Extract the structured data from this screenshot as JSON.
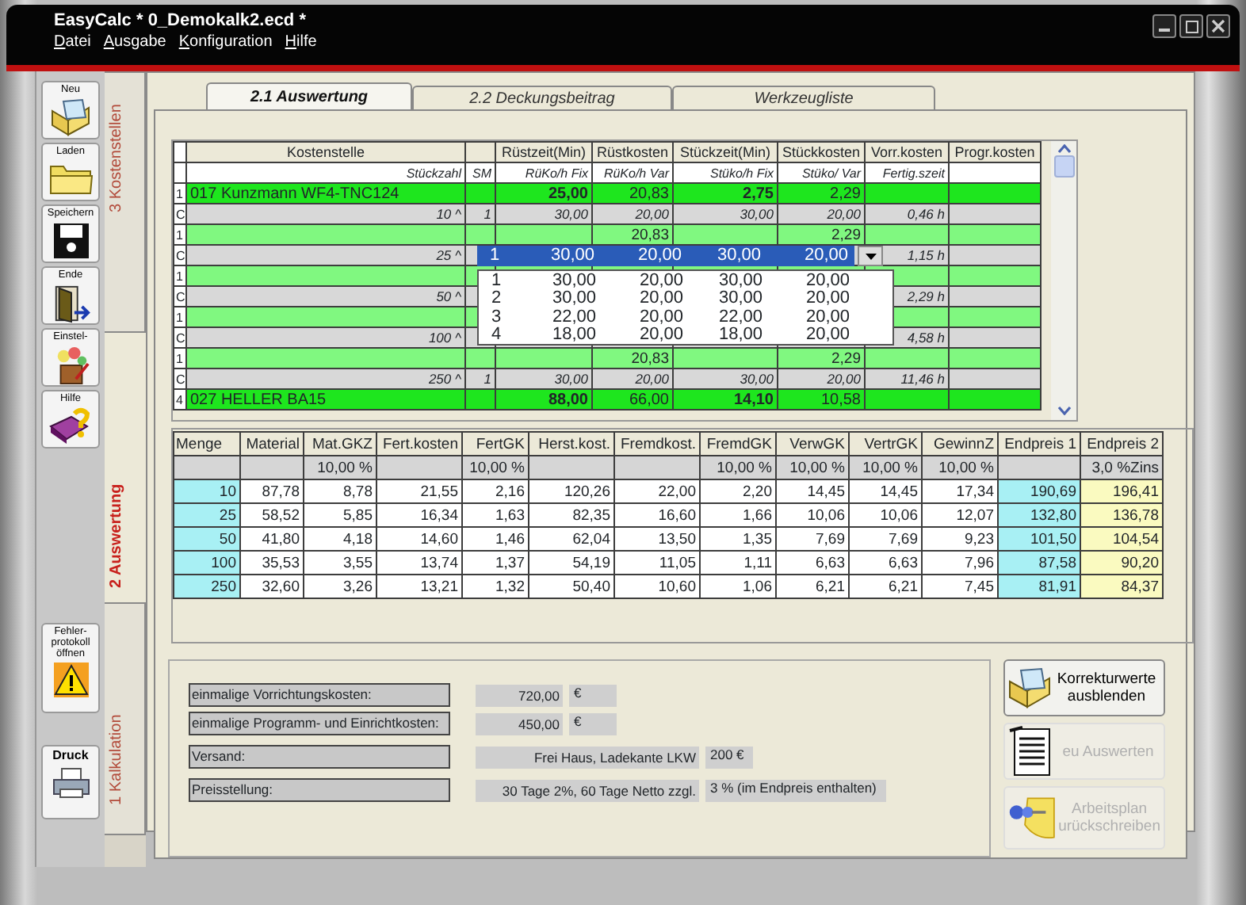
{
  "window": {
    "title": "EasyCalc * 0_Demokalk2.ecd *",
    "menu": [
      "Datei",
      "Ausgabe",
      "Konfiguration",
      "Hilfe"
    ]
  },
  "toolbar": [
    {
      "label": "Neu",
      "kind": "new"
    },
    {
      "label": "Laden",
      "kind": "open"
    },
    {
      "label": "Speichern",
      "kind": "save"
    },
    {
      "label": "Ende",
      "kind": "exit"
    },
    {
      "label": "Einstel-",
      "kind": "settings"
    },
    {
      "label": "Hilfe",
      "kind": "help"
    }
  ],
  "toolbar_lower": [
    {
      "label": "Fehler-protokoll öffnen",
      "kind": "errorlog"
    },
    {
      "label": "Druck",
      "kind": "print"
    }
  ],
  "side_tabs": [
    {
      "label": "3 Kostenstellen",
      "selected": false
    },
    {
      "label": "2 Auswertung",
      "selected": true
    },
    {
      "label": "1 Kalkulation",
      "selected": false
    }
  ],
  "tabs": [
    {
      "label": "2.1 Auswertung",
      "selected": true
    },
    {
      "label": "2.2 Deckungsbeitrag",
      "selected": false
    },
    {
      "label": "Werkzeugliste",
      "selected": false
    }
  ],
  "cost_table": {
    "columns": [
      {
        "header": "Kostenstelle",
        "sub": "Stückzahl"
      },
      {
        "sub": "SM"
      },
      {
        "header": "Rüstzeit(Min)",
        "sub": "RüKo/h Fix"
      },
      {
        "header": "Rüstkosten",
        "sub": "RüKo/h Var"
      },
      {
        "header": "Stückzeit(Min)",
        "sub": "Stüko/h Fix"
      },
      {
        "header": "Stückkosten",
        "sub": "Stüko/ Var"
      },
      {
        "header": "Vorr.kosten",
        "sub": "Fertig.szeit"
      },
      {
        "header": "Progr.kosten"
      }
    ],
    "rows": [
      {
        "index": "1",
        "kind": "machine",
        "cells": [
          "017 Kunzmann WF4-TNC124",
          null,
          "25,00",
          "20,83",
          "2,75",
          "2,29",
          null,
          null
        ]
      },
      {
        "index": "C",
        "kind": "qty",
        "cells": [
          "10 ^",
          "1",
          "30,00",
          "20,00",
          "30,00",
          "20,00",
          "0,46 h",
          null
        ]
      },
      {
        "index": "1",
        "kind": "sum",
        "cells": [
          null,
          null,
          null,
          "20,83",
          null,
          "2,29",
          null,
          null
        ]
      },
      {
        "index": "C",
        "kind": "qty",
        "cells": [
          "25 ^",
          null,
          null,
          null,
          null,
          null,
          "1,15 h",
          null
        ]
      },
      {
        "index": "1",
        "kind": "sum",
        "cells": [
          null,
          null,
          null,
          null,
          null,
          null,
          null,
          null
        ]
      },
      {
        "index": "C",
        "kind": "qty",
        "cells": [
          "50 ^",
          null,
          null,
          null,
          null,
          null,
          "2,29 h",
          null
        ]
      },
      {
        "index": "1",
        "kind": "sum",
        "cells": [
          null,
          null,
          null,
          null,
          null,
          null,
          null,
          null
        ]
      },
      {
        "index": "C",
        "kind": "qty",
        "cells": [
          "100 ^",
          null,
          null,
          null,
          null,
          null,
          "4,58 h",
          null
        ]
      },
      {
        "index": "1",
        "kind": "sum",
        "cells": [
          null,
          null,
          null,
          "20,83",
          null,
          "2,29",
          null,
          null
        ]
      },
      {
        "index": "C",
        "kind": "qty",
        "cells": [
          "250 ^",
          "1",
          "30,00",
          "20,00",
          "30,00",
          "20,00",
          "11,46 h",
          null
        ]
      },
      {
        "index": "4",
        "kind": "machine",
        "cells": [
          "027 HELLER BA15",
          null,
          "88,00",
          "66,00",
          "14,10",
          "10,58",
          null,
          null
        ]
      }
    ],
    "combo": {
      "value": [
        "1",
        "30,00",
        "20,00",
        "30,00",
        "20,00"
      ],
      "options": [
        [
          "1",
          "30,00",
          "20,00",
          "30,00",
          "20,00"
        ],
        [
          "2",
          "30,00",
          "20,00",
          "30,00",
          "20,00"
        ],
        [
          "3",
          "22,00",
          "20,00",
          "22,00",
          "20,00"
        ],
        [
          "4",
          "18,00",
          "20,00",
          "18,00",
          "20,00"
        ]
      ]
    }
  },
  "price_table": {
    "columns": [
      {
        "header": "Menge",
        "kind": "key"
      },
      {
        "header": "Material",
        "kind": "value"
      },
      {
        "header": "Mat.GKZ",
        "sub": "10,00 %",
        "kind": "value"
      },
      {
        "header": "Fert.kosten",
        "kind": "value"
      },
      {
        "header": "FertGK",
        "sub": "10,00 %",
        "kind": "value"
      },
      {
        "header": "Herst.kost.",
        "kind": "value"
      },
      {
        "header": "Fremdkost.",
        "kind": "value"
      },
      {
        "header": "FremdGK",
        "sub": "10,00 %",
        "kind": "value"
      },
      {
        "header": "VerwGK",
        "sub": "10,00 %",
        "kind": "value"
      },
      {
        "header": "VertrGK",
        "sub": "10,00 %",
        "kind": "value"
      },
      {
        "header": "GewinnZ",
        "sub": "10,00 %",
        "kind": "value"
      },
      {
        "header": "Endpreis 1",
        "kind": "price"
      },
      {
        "header": "Endpreis 2",
        "sub": "3,0 %Zins",
        "kind": "price_interest"
      }
    ],
    "rows": [
      [
        "10",
        "87,78",
        "8,78",
        "21,55",
        "2,16",
        "120,26",
        "22,00",
        "2,20",
        "14,45",
        "14,45",
        "17,34",
        "190,69",
        "196,41"
      ],
      [
        "25",
        "58,52",
        "5,85",
        "16,34",
        "1,63",
        "82,35",
        "16,60",
        "1,66",
        "10,06",
        "10,06",
        "12,07",
        "132,80",
        "136,78"
      ],
      [
        "50",
        "41,80",
        "4,18",
        "14,60",
        "1,46",
        "62,04",
        "13,50",
        "1,35",
        "7,69",
        "7,69",
        "9,23",
        "101,50",
        "104,54"
      ],
      [
        "100",
        "35,53",
        "3,55",
        "13,74",
        "1,37",
        "54,19",
        "11,05",
        "1,11",
        "6,63",
        "6,63",
        "7,96",
        "87,58",
        "90,20"
      ],
      [
        "250",
        "32,60",
        "3,26",
        "13,21",
        "1,32",
        "50,40",
        "10,60",
        "1,06",
        "6,21",
        "6,21",
        "7,45",
        "81,91",
        "84,37"
      ]
    ]
  },
  "fields": [
    {
      "label": "einmalige Vorrichtungskosten:",
      "value": "720,00",
      "unit": "€",
      "kind": "amount"
    },
    {
      "label": "einmalige Programm- und Einrichtkosten:",
      "value": "450,00",
      "unit": "€",
      "kind": "amount"
    },
    {
      "label": "Versand:",
      "value": "Frei Haus, Ladekante LKW",
      "unit": "200 €",
      "kind": "text"
    },
    {
      "label": "Preisstellung:",
      "value": "30 Tage 2%, 60 Tage Netto zzgl.",
      "unit": "3 %  (im Endpreis enthalten)",
      "kind": "text"
    }
  ],
  "actions": [
    {
      "label": "Korrekturwerte ausblenden",
      "kind": "correction",
      "disabled": false
    },
    {
      "label": "eu Auswerten",
      "kind": "evaluate",
      "disabled": true
    },
    {
      "label": "Arbeitsplan urückschreiben",
      "kind": "writeback",
      "disabled": true
    }
  ]
}
